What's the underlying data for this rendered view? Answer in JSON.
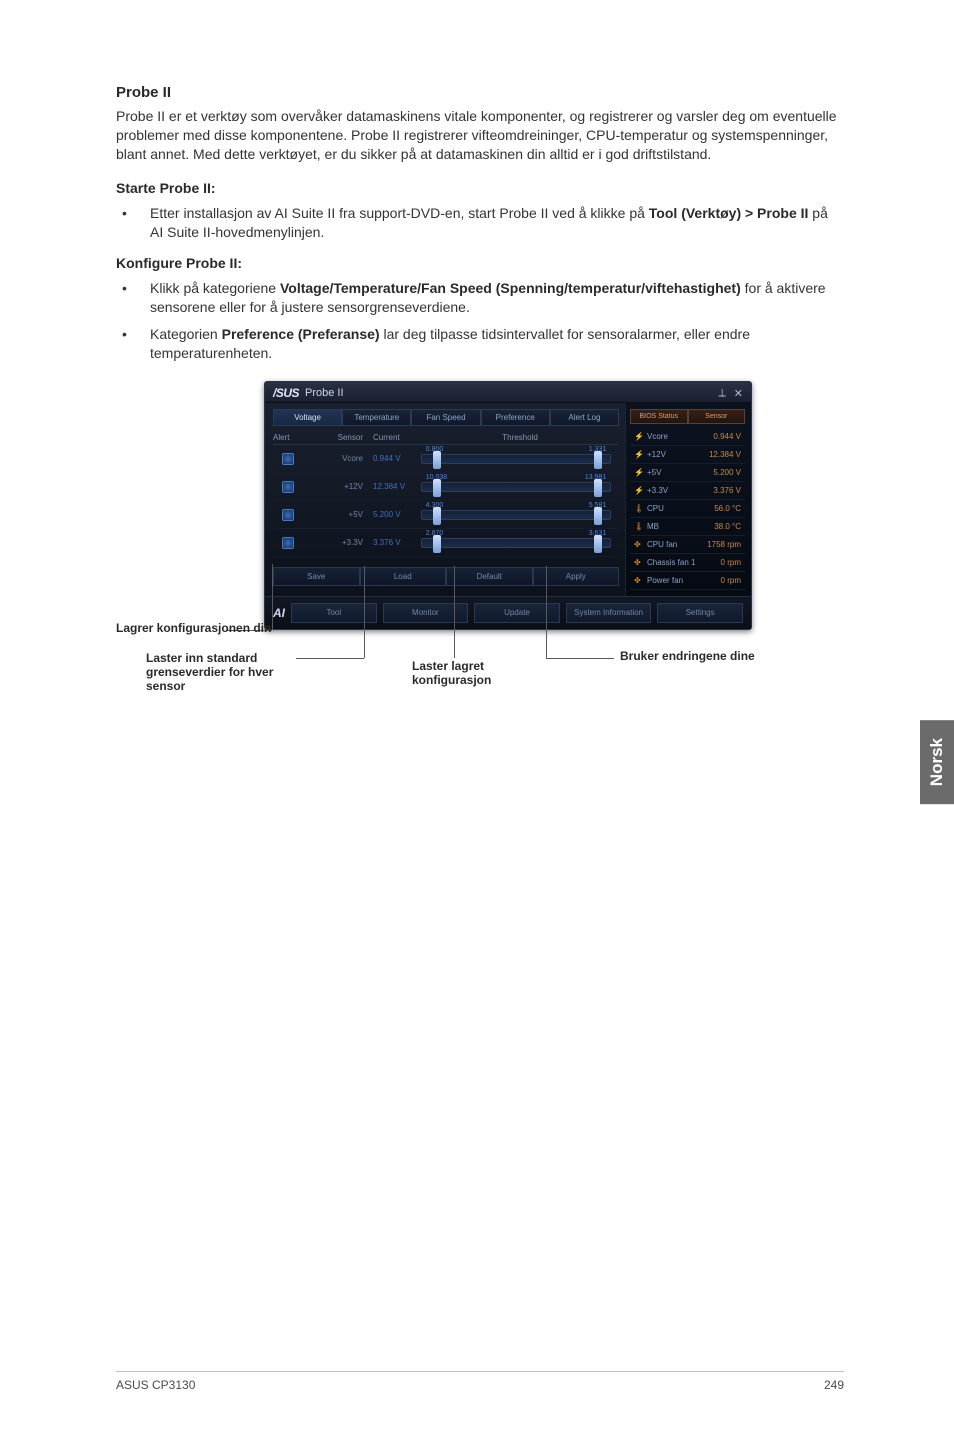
{
  "section": {
    "title": "Probe II",
    "intro": "Probe II er et verktøy som overvåker datamaskinens vitale komponenter, og registrerer og varsler deg om eventuelle problemer med disse komponentene. Probe II registrerer vifteomdreininger, CPU-temperatur og systemspenninger, blant annet. Med dette verktøyet, er du sikker på at datamaskinen din alltid er i god driftstilstand.",
    "start_title": "Starte Probe II:",
    "start_bullet_prefix": "Etter installasjon av AI Suite II fra support-DVD-en, start Probe II ved å klikke på ",
    "start_bullet_bold": "Tool (Verktøy) > Probe II",
    "start_bullet_suffix": " på AI Suite II-hovedmenylinjen.",
    "config_title": "Konfigure Probe II:",
    "config_bullet1_prefix": "Klikk på kategoriene ",
    "config_bullet1_bold": "Voltage/Temperature/Fan Speed (Spenning/temperatur/viftehastighet)",
    "config_bullet1_suffix": " for å aktivere sensorene eller for å justere sensorgrenseverdiene.",
    "config_bullet2_prefix": "Kategorien ",
    "config_bullet2_bold": "Preference (Preferanse)",
    "config_bullet2_suffix": " lar deg tilpasse tidsintervallet for sensoralarmer, eller endre temperaturenheten."
  },
  "side_tab": "Norsk",
  "window": {
    "brand": "/SUS",
    "title": "Probe II",
    "tabs": [
      "Voltage",
      "Temperature",
      "Fan Speed",
      "Preference",
      "Alert Log"
    ],
    "headers": {
      "alert": "Alert",
      "sensor": "Sensor",
      "current": "Current",
      "threshold": "Threshold"
    },
    "rows": [
      {
        "sensor": "Vcore",
        "current": "0.944 V",
        "lo": "0.800",
        "hi": "1.331"
      },
      {
        "sensor": "+12V",
        "current": "12.384 V",
        "lo": "10.038",
        "hi": "13.981"
      },
      {
        "sensor": "+5V",
        "current": "5.200 V",
        "lo": "4.300",
        "hi": "5.581"
      },
      {
        "sensor": "+3.3V",
        "current": "3.376 V",
        "lo": "2.870",
        "hi": "3.631"
      }
    ],
    "action_buttons": [
      "Save",
      "Load",
      "Default",
      "Apply"
    ],
    "bottom_buttons": [
      "Tool",
      "Monitor",
      "Update",
      "System Information",
      "Settings"
    ],
    "status_tabs": [
      "BIOS Status",
      "Sensor"
    ],
    "status": [
      {
        "icon": "⚡",
        "name": "Vcore",
        "value": "0.944 V"
      },
      {
        "icon": "⚡",
        "name": "+12V",
        "value": "12.384 V"
      },
      {
        "icon": "⚡",
        "name": "+5V",
        "value": "5.200 V"
      },
      {
        "icon": "⚡",
        "name": "+3.3V",
        "value": "3.376 V"
      },
      {
        "icon": "🌡",
        "name": "CPU",
        "value": "56.0 °C"
      },
      {
        "icon": "🌡",
        "name": "MB",
        "value": "38.0 °C"
      },
      {
        "icon": "✤",
        "name": "CPU fan",
        "value": "1758 rpm"
      },
      {
        "icon": "✤",
        "name": "Chassis fan 1",
        "value": "0 rpm"
      },
      {
        "icon": "✤",
        "name": "Power fan",
        "value": "0 rpm"
      }
    ]
  },
  "callouts": {
    "save": "Lagrer konfigurasjonen din",
    "load": "Laster inn standard grenseverdier for hver sensor",
    "default": "Laster lagret konfigurasjon",
    "apply_prefix": "Bruker en",
    "apply_bold": "dringene dine"
  },
  "footer": {
    "left": "ASUS CP3130",
    "right": "249"
  }
}
